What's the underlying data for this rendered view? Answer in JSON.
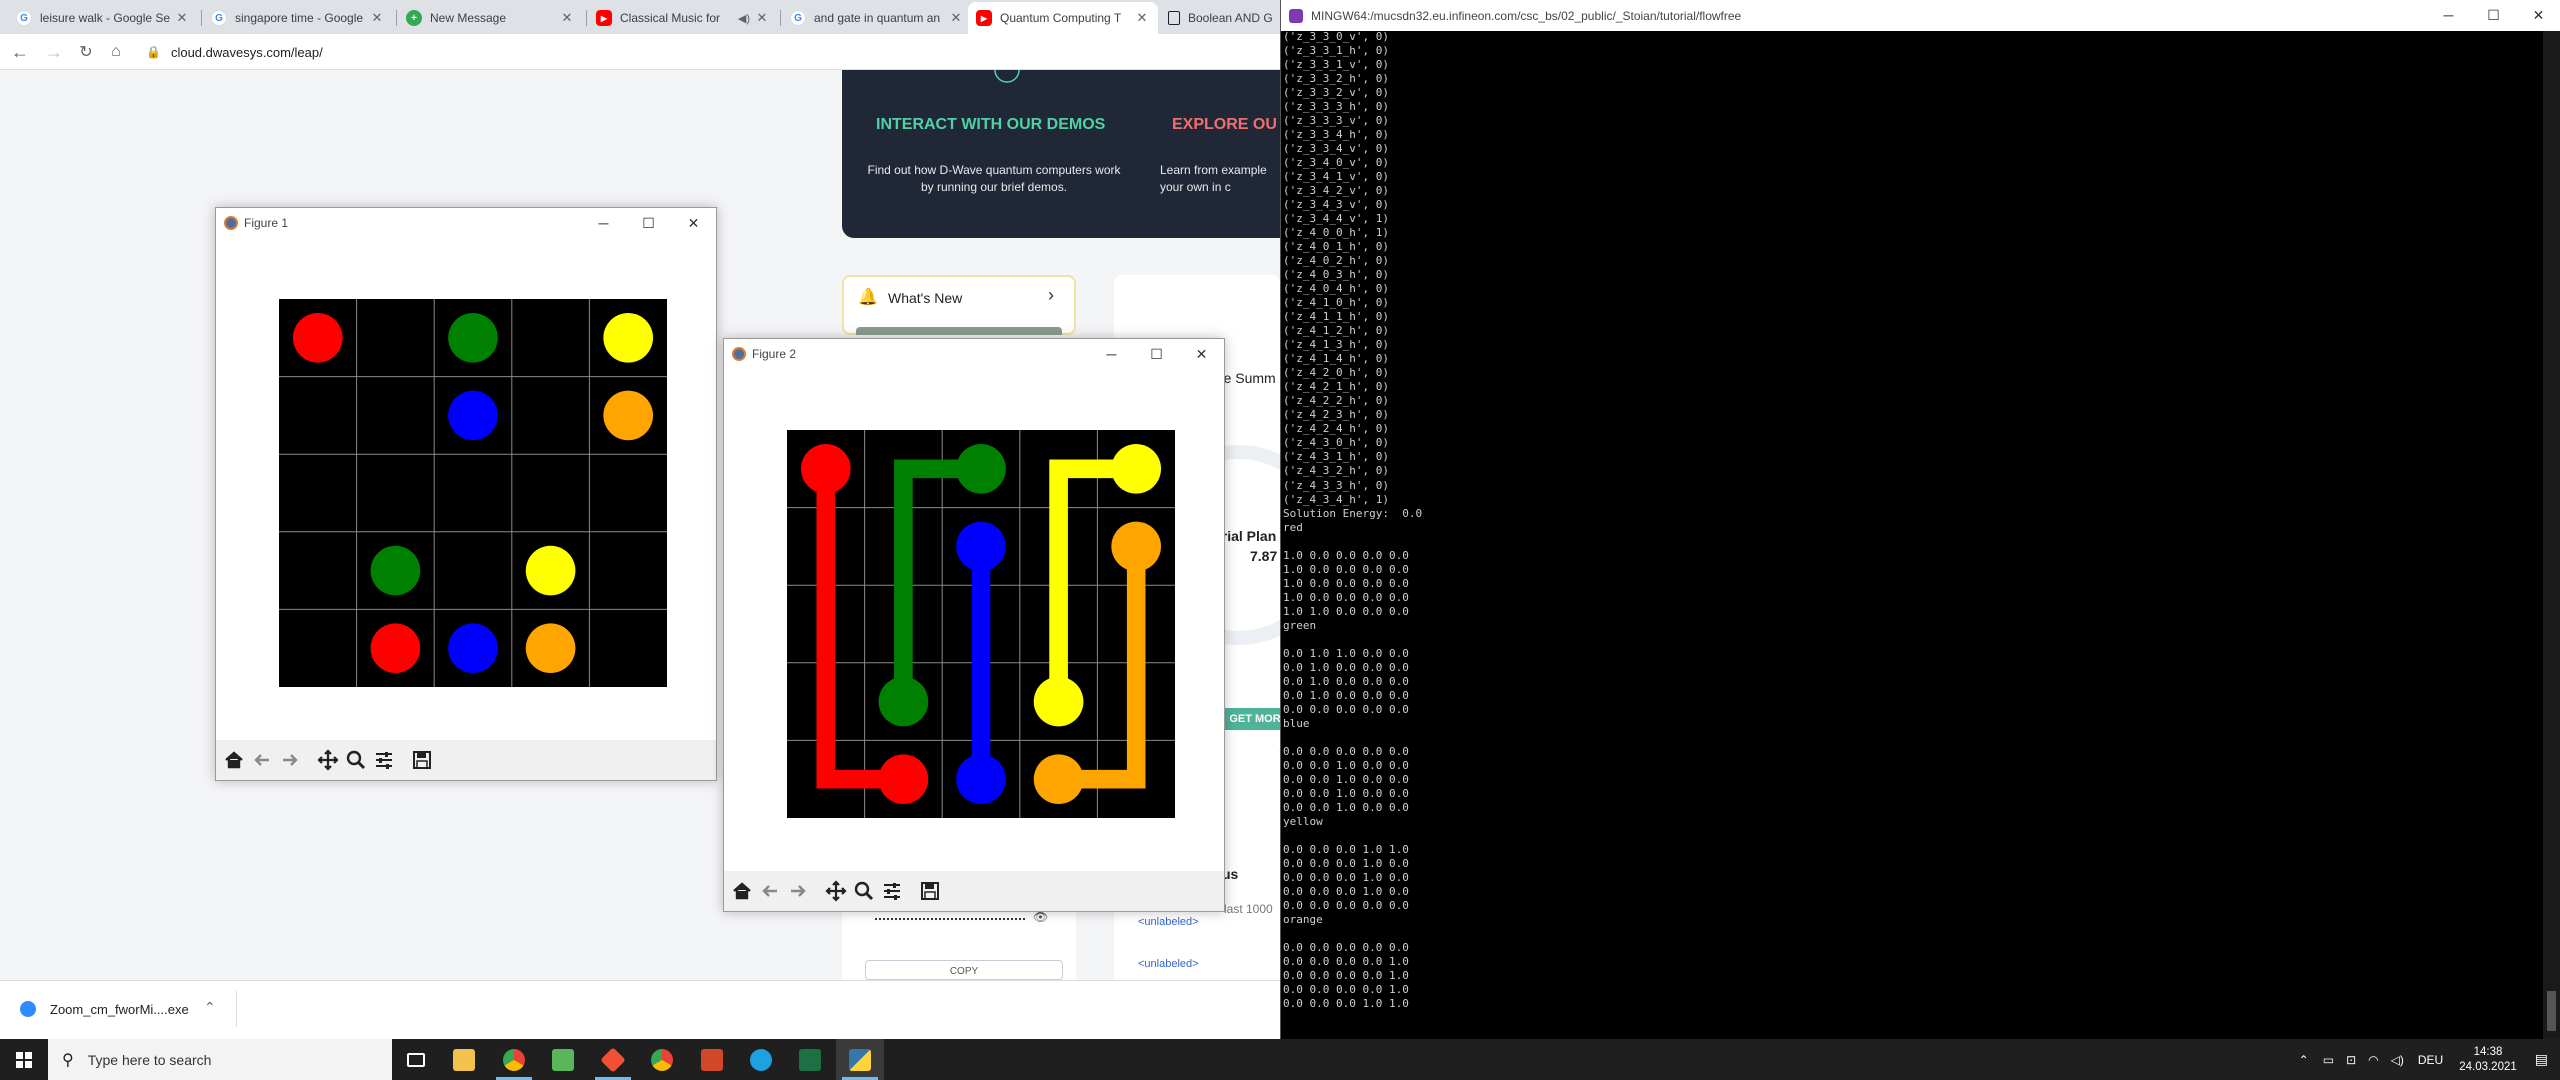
{
  "browser": {
    "tabs": [
      {
        "title": "leisure walk - Google Se",
        "favicon": "google-icon",
        "color": "#4285f4"
      },
      {
        "title": "singapore time - Google",
        "favicon": "google-icon",
        "color": "#4285f4"
      },
      {
        "title": "New Message",
        "favicon": "new-message-icon",
        "color": "#34a853"
      },
      {
        "title": "Classical Music for",
        "favicon": "youtube-icon",
        "color": "#ff0000"
      },
      {
        "title": "and gate in quantum an",
        "favicon": "google-icon",
        "color": "#4285f4"
      },
      {
        "title": "Quantum Computing T",
        "favicon": "youtube-icon",
        "color": "#ff0000"
      },
      {
        "title": "Boolean AND Ga",
        "favicon": "book-icon",
        "color": "#202124"
      }
    ],
    "url": "cloud.dwavesys.com/leap/"
  },
  "leap": {
    "demos_title": "INTERACT WITH OUR DEMOS",
    "demos_text": "Find out how D-Wave quantum computers work by running our brief demos.",
    "explore_title": "EXPLORE OU",
    "explore_text": "Learn from example your own in c",
    "whats_new": "What's New",
    "usage_title": "Monthly Usage Summ",
    "trial_plan": "Trial Plan",
    "trial_value": "7.87",
    "get_more": "GET MOR",
    "status_frag": "us",
    "last_frag": "last 1000",
    "link1": "<unlabeled>",
    "link2": "<unlabeled>",
    "copy": "COPY"
  },
  "download": {
    "filename": "Zoom_cm_fworMi....exe"
  },
  "figure1": {
    "title": "Figure 1"
  },
  "figure2": {
    "title": "Figure 2"
  },
  "flow_colors": {
    "red": "#ff0000",
    "green": "#008000",
    "blue": "#0000ff",
    "yellow": "#ffff00",
    "orange": "#ffa500"
  },
  "figure1_board": {
    "size": 5,
    "dots": [
      {
        "color": "red",
        "row": 0,
        "col": 0
      },
      {
        "color": "green",
        "row": 0,
        "col": 2
      },
      {
        "color": "yellow",
        "row": 0,
        "col": 4
      },
      {
        "color": "blue",
        "row": 1,
        "col": 2
      },
      {
        "color": "orange",
        "row": 1,
        "col": 4
      },
      {
        "color": "green",
        "row": 3,
        "col": 1
      },
      {
        "color": "yellow",
        "row": 3,
        "col": 3
      },
      {
        "color": "red",
        "row": 4,
        "col": 1
      },
      {
        "color": "blue",
        "row": 4,
        "col": 2
      },
      {
        "color": "orange",
        "row": 4,
        "col": 3
      }
    ]
  },
  "figure2_board": {
    "size": 5,
    "paths": [
      {
        "color": "red",
        "cells": [
          [
            0,
            0
          ],
          [
            1,
            0
          ],
          [
            2,
            0
          ],
          [
            3,
            0
          ],
          [
            4,
            0
          ],
          [
            4,
            1
          ]
        ]
      },
      {
        "color": "green",
        "cells": [
          [
            0,
            2
          ],
          [
            0,
            1
          ],
          [
            1,
            1
          ],
          [
            2,
            1
          ],
          [
            3,
            1
          ]
        ]
      },
      {
        "color": "blue",
        "cells": [
          [
            1,
            2
          ],
          [
            2,
            2
          ],
          [
            3,
            2
          ],
          [
            4,
            2
          ]
        ]
      },
      {
        "color": "yellow",
        "cells": [
          [
            0,
            4
          ],
          [
            0,
            3
          ],
          [
            1,
            3
          ],
          [
            2,
            3
          ],
          [
            3,
            3
          ]
        ]
      },
      {
        "color": "orange",
        "cells": [
          [
            1,
            4
          ],
          [
            2,
            4
          ],
          [
            3,
            4
          ],
          [
            4,
            4
          ],
          [
            4,
            3
          ]
        ]
      }
    ],
    "endpoints": [
      {
        "color": "red",
        "row": 0,
        "col": 0
      },
      {
        "color": "red",
        "row": 4,
        "col": 1
      },
      {
        "color": "green",
        "row": 0,
        "col": 2
      },
      {
        "color": "green",
        "row": 3,
        "col": 1
      },
      {
        "color": "blue",
        "row": 1,
        "col": 2
      },
      {
        "color": "blue",
        "row": 4,
        "col": 2
      },
      {
        "color": "yellow",
        "row": 0,
        "col": 4
      },
      {
        "color": "yellow",
        "row": 3,
        "col": 3
      },
      {
        "color": "orange",
        "row": 1,
        "col": 4
      },
      {
        "color": "orange",
        "row": 4,
        "col": 3
      }
    ]
  },
  "terminal": {
    "title": "MINGW64:/mucsdn32.eu.infineon.com/csc_bs/02_public/_Stoian/tutorial/flowfree",
    "lines": [
      "('z_3_3_0_v', 0)",
      "('z_3_3_1_h', 0)",
      "('z_3_3_1_v', 0)",
      "('z_3_3_2_h', 0)",
      "('z_3_3_2_v', 0)",
      "('z_3_3_3_h', 0)",
      "('z_3_3_3_v', 0)",
      "('z_3_3_4_h', 0)",
      "('z_3_3_4_v', 0)",
      "('z_3_4_0_v', 0)",
      "('z_3_4_1_v', 0)",
      "('z_3_4_2_v', 0)",
      "('z_3_4_3_v', 0)",
      "('z_3_4_4_v', 1)",
      "('z_4_0_0_h', 1)",
      "('z_4_0_1_h', 0)",
      "('z_4_0_2_h', 0)",
      "('z_4_0_3_h', 0)",
      "('z_4_0_4_h', 0)",
      "('z_4_1_0_h', 0)",
      "('z_4_1_1_h', 0)",
      "('z_4_1_2_h', 0)",
      "('z_4_1_3_h', 0)",
      "('z_4_1_4_h', 0)",
      "('z_4_2_0_h', 0)",
      "('z_4_2_1_h', 0)",
      "('z_4_2_2_h', 0)",
      "('z_4_2_3_h', 0)",
      "('z_4_2_4_h', 0)",
      "('z_4_3_0_h', 0)",
      "('z_4_3_1_h', 0)",
      "('z_4_3_2_h', 0)",
      "('z_4_3_3_h', 0)",
      "('z_4_3_4_h', 1)",
      "Solution Energy:  0.0",
      "red",
      "",
      "1.0 0.0 0.0 0.0 0.0",
      "1.0 0.0 0.0 0.0 0.0",
      "1.0 0.0 0.0 0.0 0.0",
      "1.0 0.0 0.0 0.0 0.0",
      "1.0 1.0 0.0 0.0 0.0",
      "green",
      "",
      "0.0 1.0 1.0 0.0 0.0",
      "0.0 1.0 0.0 0.0 0.0",
      "0.0 1.0 0.0 0.0 0.0",
      "0.0 1.0 0.0 0.0 0.0",
      "0.0 0.0 0.0 0.0 0.0",
      "blue",
      "",
      "0.0 0.0 0.0 0.0 0.0",
      "0.0 0.0 1.0 0.0 0.0",
      "0.0 0.0 1.0 0.0 0.0",
      "0.0 0.0 1.0 0.0 0.0",
      "0.0 0.0 1.0 0.0 0.0",
      "yellow",
      "",
      "0.0 0.0 0.0 1.0 1.0",
      "0.0 0.0 0.0 1.0 0.0",
      "0.0 0.0 0.0 1.0 0.0",
      "0.0 0.0 0.0 1.0 0.0",
      "0.0 0.0 0.0 0.0 0.0",
      "orange",
      "",
      "0.0 0.0 0.0 0.0 0.0",
      "0.0 0.0 0.0 0.0 1.0",
      "0.0 0.0 0.0 0.0 1.0",
      "0.0 0.0 0.0 0.0 1.0",
      "0.0 0.0 0.0 1.0 1.0"
    ]
  },
  "taskbar": {
    "search_placeholder": "Type here to search",
    "language": "DEU",
    "time": "14:38",
    "date": "24.03.2021"
  }
}
